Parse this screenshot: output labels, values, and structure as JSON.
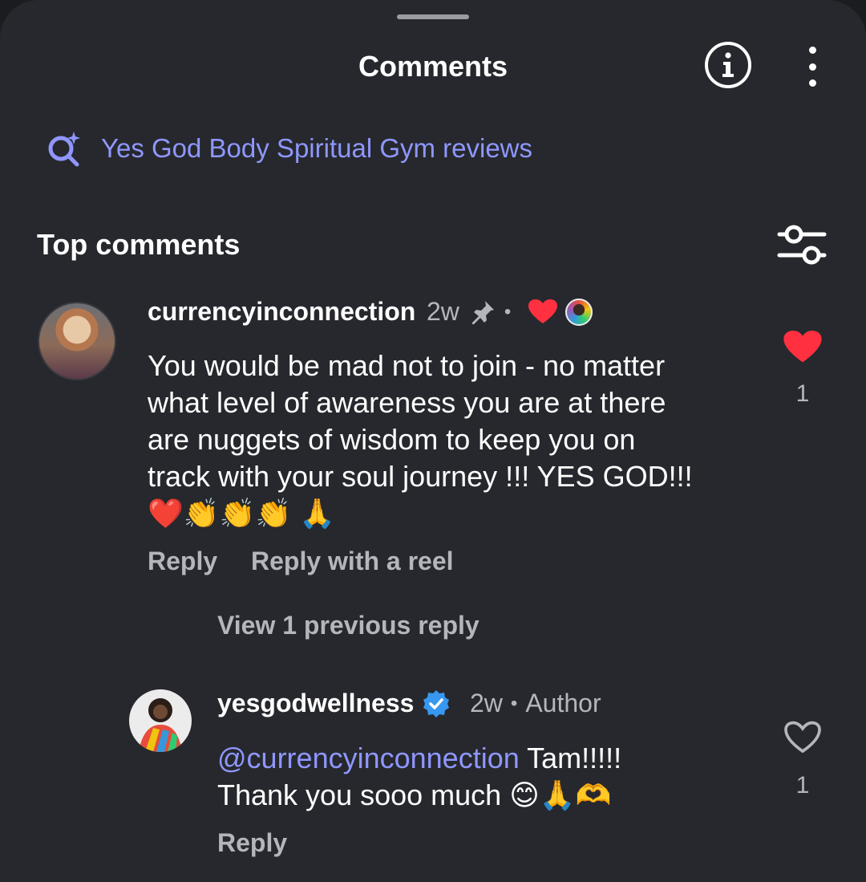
{
  "header": {
    "title": "Comments"
  },
  "search": {
    "label": "Yes God Body Spiritual Gym reviews"
  },
  "section": {
    "title": "Top comments"
  },
  "comments": [
    {
      "username": "currencyinconnection",
      "time": "2w",
      "text_line1": "You would be mad not to join - no matter",
      "text_line2": "what level of awareness you are at there",
      "text_line3": "are nuggets of wisdom to keep you on",
      "text_line4": "track with your soul journey !!! YES GOD!!!",
      "emojis": "❤️👏👏👏 🙏",
      "reply_label": "Reply",
      "reply_reel_label": "Reply with a reel",
      "like_count": "1",
      "liked": true
    }
  ],
  "view_replies": "View 1 previous reply",
  "reply": {
    "username": "yesgodwellness",
    "time": "2w",
    "author_label": "Author",
    "mention": "@currencyinconnection",
    "text_after_mention": " Tam!!!!!",
    "text_line2": "Thank you sooo much 😊🙏🫶",
    "reply_label": "Reply",
    "like_count": "1",
    "liked": false
  },
  "colors": {
    "background": "#26282d",
    "accent": "#8f97ff",
    "like_red": "#ff3040",
    "verified_blue": "#3897f0",
    "secondary_text": "#b4b6bc"
  }
}
